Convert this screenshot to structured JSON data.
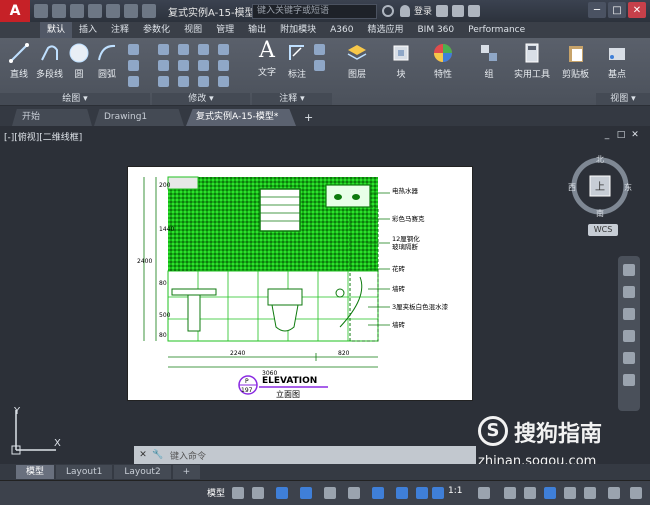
{
  "titlebar": {
    "logo": "A",
    "doc_title": "复式实例A-15-模型.dwg",
    "search_placeholder": "键入关键字或短语",
    "signin": "登录",
    "win_min": "─",
    "win_max": "□",
    "win_close": "✕"
  },
  "ribbon_tabs": [
    "默认",
    "插入",
    "注释",
    "参数化",
    "视图",
    "管理",
    "输出",
    "附加模块",
    "A360",
    "精选应用",
    "BIM 360",
    "Performance"
  ],
  "ribbon": {
    "draw_tools": [
      "直线",
      "多段线",
      "圆",
      "圆弧"
    ],
    "text_tool": "文字",
    "dim_tool": "标注",
    "layer_tool": "图层",
    "block_tool": "块",
    "props_tool": "特性",
    "group_tool": "组",
    "utils_tool": "实用工具",
    "clipboard_tool": "剪贴板",
    "base_tool": "基点",
    "panel_draw": "绘图 ▾",
    "panel_modify": "修改 ▾",
    "panel_annot": "注释 ▾",
    "panel_view": "视图 ▾"
  },
  "file_tabs": [
    "开始",
    "Drawing1",
    "复式实例A-15-模型*"
  ],
  "new_tab": "+",
  "viewport": {
    "label": "[-][俯视][二维线框]",
    "restore": "_",
    "maximize": "□",
    "close": "✕"
  },
  "drawing": {
    "labels": [
      "电热水器",
      "彩色马赛克",
      "12厘钢化",
      "玻璃隔断",
      "花砖",
      "墙砖",
      "3厘夹板白色混水漆",
      "墙砖"
    ],
    "dims_vertical": [
      "200",
      "1440",
      "2400",
      "80",
      "500",
      "80"
    ],
    "dims_horizontal": [
      "2240",
      "820",
      "3060"
    ],
    "title": "ELEVATION",
    "subtitle": "立面图",
    "tag_top": "P",
    "tag_bottom": "197"
  },
  "viewcube": {
    "north": "北",
    "south": "南",
    "east": "东",
    "west": "西",
    "face": "上",
    "wcs": "WCS"
  },
  "ucs": {
    "y": "Y",
    "x": "X"
  },
  "command_line": {
    "close": "✕",
    "settings": "🔧",
    "placeholder": "键入命令"
  },
  "watermark": {
    "logo": "S",
    "text": "搜狗指南",
    "url": "zhinan.sogou.com"
  },
  "layout_tabs": [
    "模型",
    "Layout1",
    "Layout2"
  ],
  "layout_new": "+",
  "status": {
    "model": "模型",
    "scale": "1:1"
  }
}
